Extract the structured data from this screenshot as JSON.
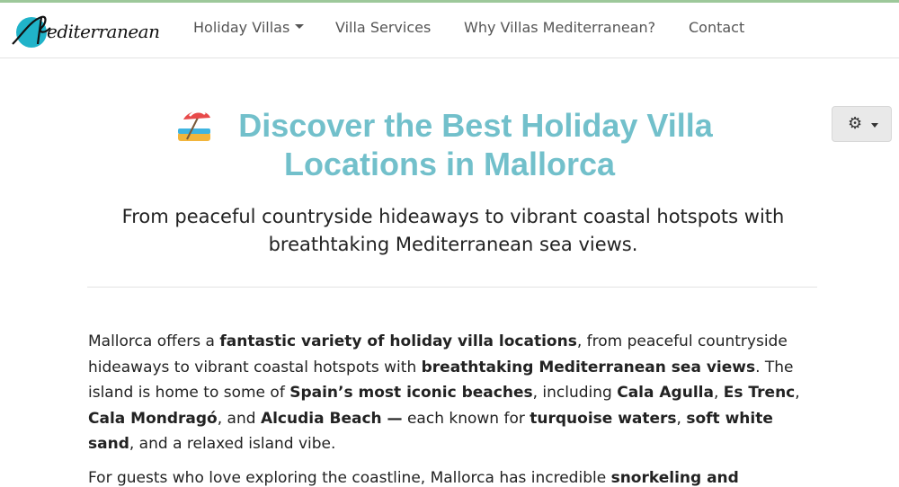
{
  "brand": {
    "logo_text": "editerranean",
    "logo_color": "#20b3c9"
  },
  "nav": {
    "items": [
      {
        "label": "Holiday Villas",
        "has_dropdown": true
      },
      {
        "label": "Villa Services",
        "has_dropdown": false
      },
      {
        "label": "Why Villas Mediterranean?",
        "has_dropdown": false
      },
      {
        "label": "Contact",
        "has_dropdown": false
      }
    ]
  },
  "settings": {
    "icon": "gear-icon",
    "dropdown_icon": "caret-down-icon"
  },
  "hero": {
    "icon": "beach-umbrella-icon",
    "title_line1": "Discover the Best Holiday Villa",
    "title_line2": "Locations in Mallorca",
    "title_color": "#72c0cb",
    "subtitle_line1": "From peaceful countryside hideaways to vibrant coastal hotspots with",
    "subtitle_line2": "breathtaking Mediterranean sea views."
  },
  "body": {
    "p1": {
      "t1": "Mallorca offers a ",
      "b1": "fantastic variety of holiday villa locations",
      "t2": ", from peaceful countryside hideaways to vibrant coastal hotspots with ",
      "b2": "breathtaking Mediterranean sea views",
      "t3": ". The island is home to some of ",
      "b3": "Spain’s most iconic beaches",
      "t4": ", including ",
      "b4": "Cala Agulla",
      "t5": ", ",
      "b5": "Es Trenc",
      "t6": ", ",
      "b6": "Cala Mondragó",
      "t7": ", and ",
      "b7": "Alcudia Beach —",
      "t8": " each known for ",
      "b8": "turquoise waters",
      "t9": ", ",
      "b9": "soft white sand",
      "t10": ", and a relaxed island vibe."
    },
    "p2": {
      "t1": "For guests who love exploring the coastline, Mallorca has incredible ",
      "b1": "snorkeling and"
    }
  }
}
